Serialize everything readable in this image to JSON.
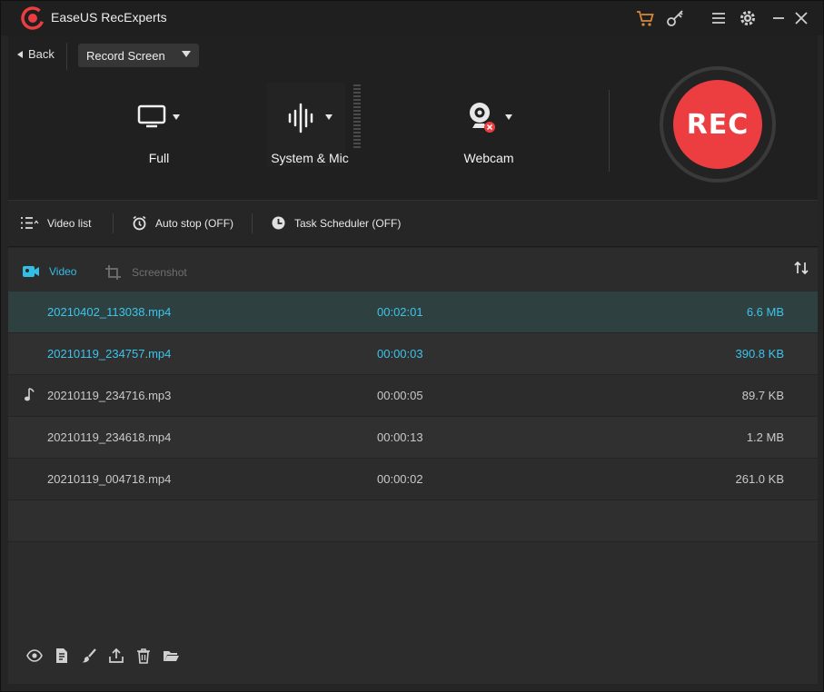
{
  "app": {
    "title": "EaseUS RecExperts"
  },
  "titlebar": {
    "icons": [
      "cart-icon",
      "key-icon",
      "menu-icon",
      "settings-icon",
      "minimize-icon",
      "close-icon"
    ]
  },
  "control": {
    "back_label": "Back",
    "mode_selected": "Record Screen",
    "sources": {
      "screen": {
        "label": "Full",
        "icon": "monitor-icon"
      },
      "audio": {
        "label": "System & Mic",
        "icon": "soundwave-icon"
      },
      "webcam": {
        "label": "Webcam",
        "icon": "webcam-icon"
      }
    },
    "rec_label": "REC"
  },
  "toolbar": {
    "video_list": "Video list",
    "auto_stop": "Auto stop (OFF)",
    "task_scheduler": "Task Scheduler (OFF)"
  },
  "tabs": {
    "video": "Video",
    "screenshot": "Screenshot"
  },
  "files": [
    {
      "name": "20210402_113038.mp4",
      "duration": "00:02:01",
      "size": "6.6 MB",
      "type": "video",
      "state": "selected"
    },
    {
      "name": "20210119_234757.mp4",
      "duration": "00:00:03",
      "size": "390.8 KB",
      "type": "video",
      "state": "highlight"
    },
    {
      "name": "20210119_234716.mp3",
      "duration": "00:00:05",
      "size": "89.7 KB",
      "type": "audio",
      "state": "normal"
    },
    {
      "name": "20210119_234618.mp4",
      "duration": "00:00:13",
      "size": "1.2 MB",
      "type": "video",
      "state": "normal"
    },
    {
      "name": "20210119_004718.mp4",
      "duration": "00:00:02",
      "size": "261.0 KB",
      "type": "video",
      "state": "normal"
    }
  ],
  "colors": {
    "accent": "#34bde5",
    "rec": "#ec3d41",
    "background": "#252525",
    "selected_row": "#2e4140"
  }
}
